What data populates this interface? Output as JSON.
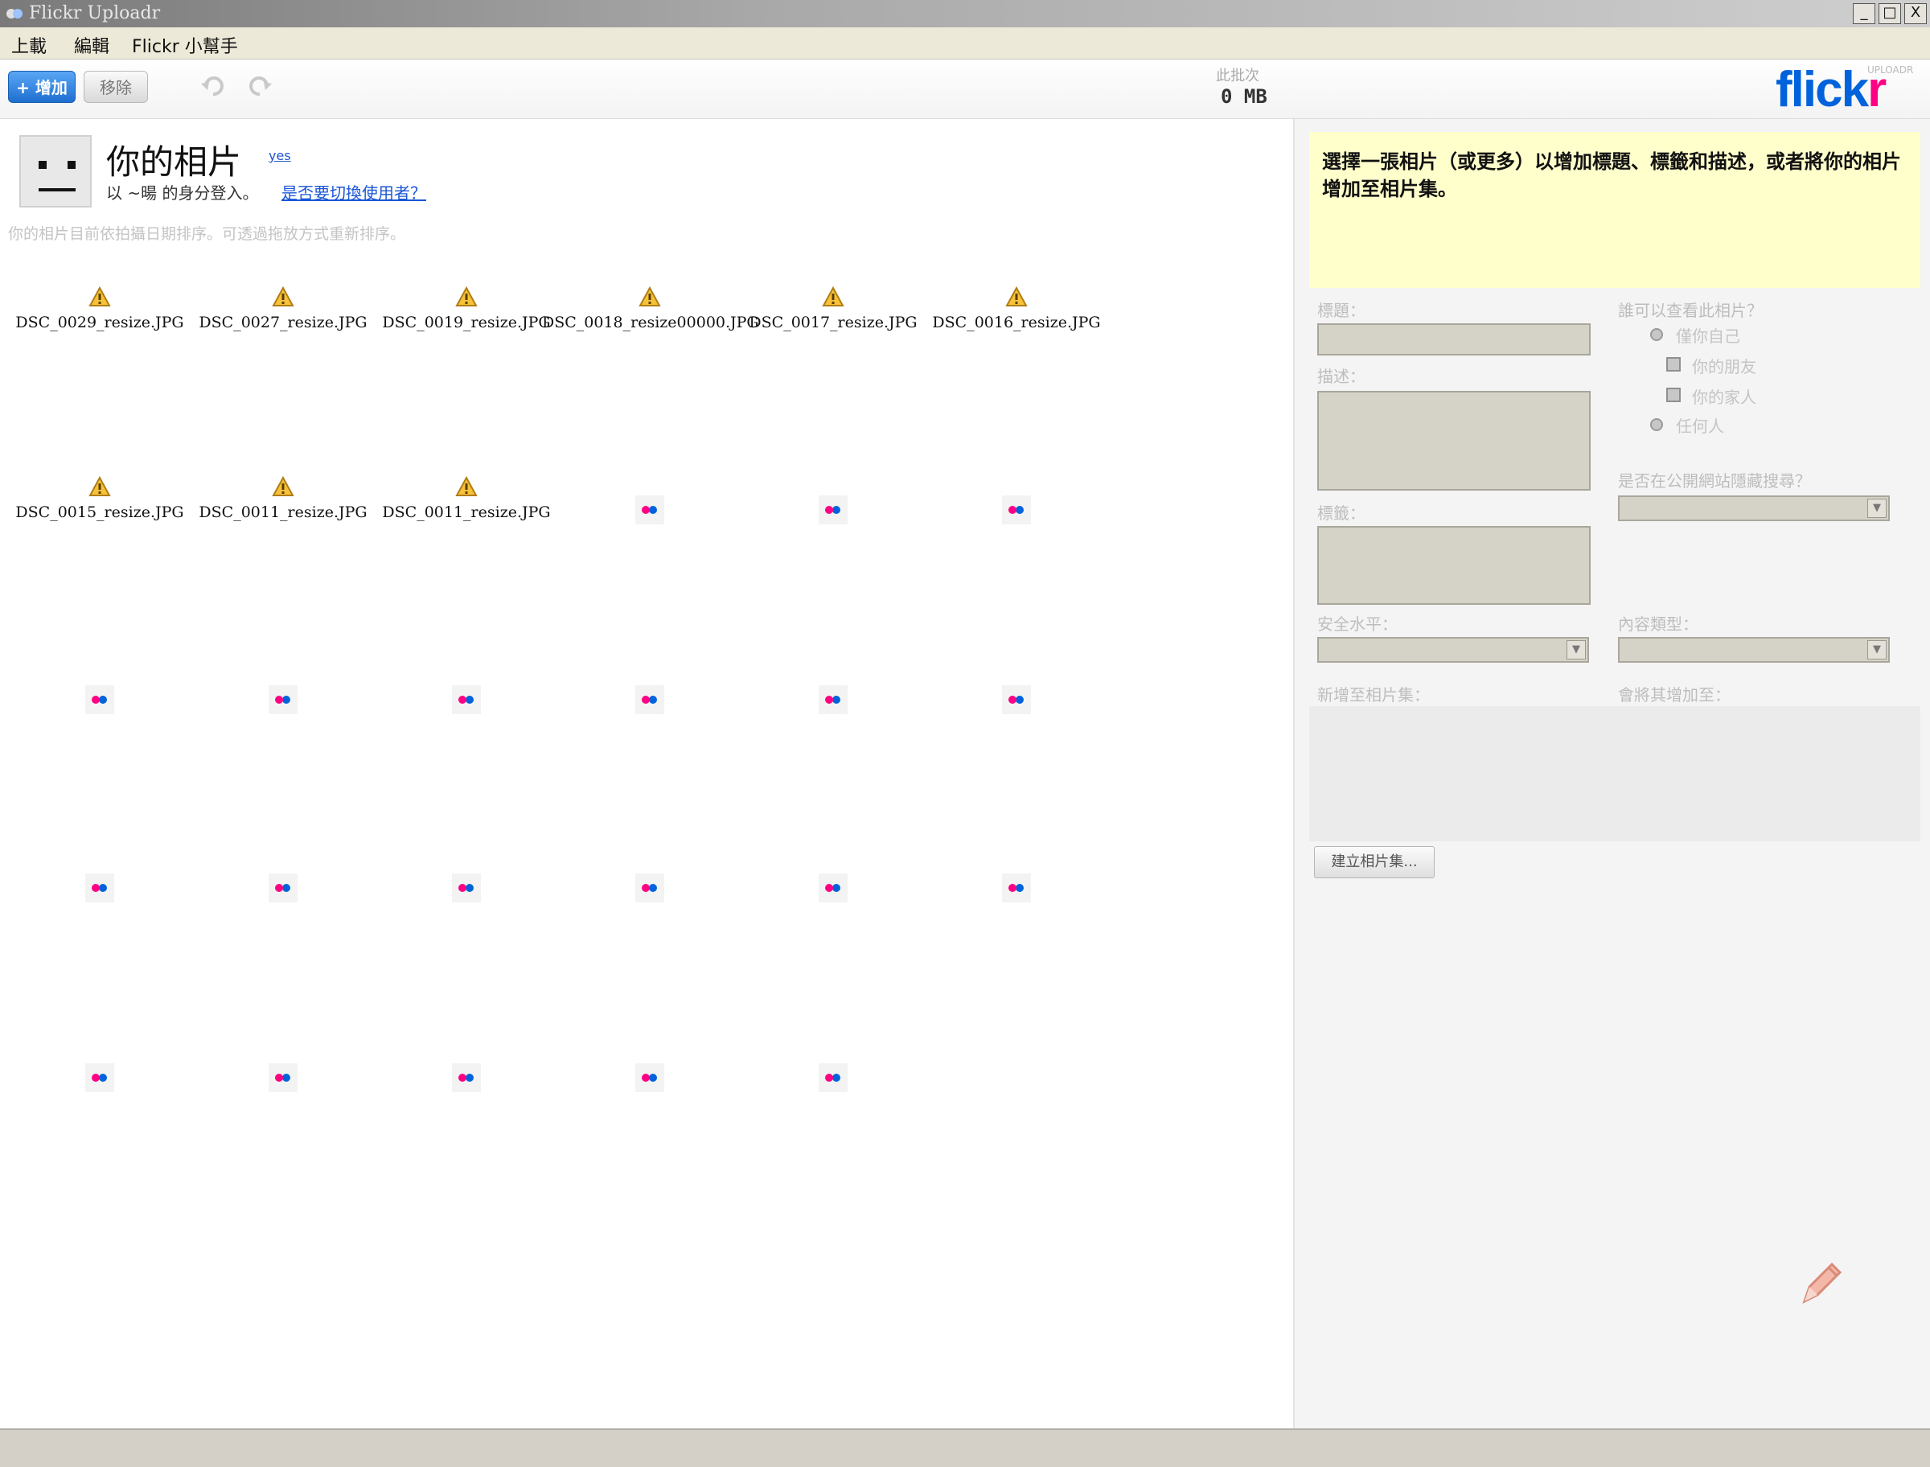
{
  "window": {
    "title": "Flickr Uploadr",
    "controls": [
      "_",
      "□",
      "X"
    ]
  },
  "menubar": {
    "items": [
      "上載",
      "編輯",
      "Flickr 小幫手"
    ]
  },
  "toolbar": {
    "add_label": "+ 增加",
    "remove_label": "移除",
    "size_label": "此批次",
    "size_value": "0 MB",
    "logo_main": "flick",
    "logo_r": "r",
    "logo_sub": "UPLOADR"
  },
  "header": {
    "title": "你的相片",
    "user_small": "yes",
    "signed_in": "以 ~暘 的身分登入。",
    "switch_user": "是否要切換使用者？",
    "sort_note": "你的相片目前依拍攝日期排序。可透過拖放方式重新排序。"
  },
  "photos": [
    {
      "name": "DSC_0029_resize.JPG",
      "state": "warning"
    },
    {
      "name": "DSC_0027_resize.JPG",
      "state": "warning"
    },
    {
      "name": "DSC_0019_resize.JPG",
      "state": "warning"
    },
    {
      "name": "DSC_0018_resize00000.JPG",
      "state": "warning"
    },
    {
      "name": "DSC_0017_resize.JPG",
      "state": "warning"
    },
    {
      "name": "DSC_0016_resize.JPG",
      "state": "warning"
    },
    {
      "name": "DSC_0015_resize.JPG",
      "state": "warning"
    },
    {
      "name": "DSC_0011_resize.JPG",
      "state": "warning"
    },
    {
      "name": "DSC_0011_resize.JPG",
      "state": "warning"
    },
    {
      "name": "",
      "state": "loading"
    },
    {
      "name": "",
      "state": "loading"
    },
    {
      "name": "",
      "state": "loading"
    },
    {
      "name": "",
      "state": "loading"
    },
    {
      "name": "",
      "state": "loading"
    },
    {
      "name": "",
      "state": "loading"
    },
    {
      "name": "",
      "state": "loading"
    },
    {
      "name": "",
      "state": "loading"
    },
    {
      "name": "",
      "state": "loading"
    },
    {
      "name": "",
      "state": "loading"
    },
    {
      "name": "",
      "state": "loading"
    },
    {
      "name": "",
      "state": "loading"
    },
    {
      "name": "",
      "state": "loading"
    },
    {
      "name": "",
      "state": "loading"
    },
    {
      "name": "",
      "state": "loading"
    },
    {
      "name": "",
      "state": "loading"
    },
    {
      "name": "",
      "state": "loading"
    },
    {
      "name": "",
      "state": "loading"
    },
    {
      "name": "",
      "state": "loading"
    },
    {
      "name": "",
      "state": "loading"
    }
  ],
  "side": {
    "hint": "選擇一張相片（或更多）以增加標題、標籤和描述，或者將你的相片增加至相片集。",
    "title_label": "標題：",
    "desc_label": "描述：",
    "tags_label": "標籤：",
    "privacy_label": "誰可以查看此相片？",
    "privacy_options": [
      "僅你自己",
      "你的朋友",
      "你的家人",
      "任何人"
    ],
    "geo_label": "是否在公開網站隱藏搜尋？",
    "safety_label": "安全水平：",
    "content_label": "內容類型：",
    "add_to_set_label": "新增至相片集：",
    "other_label": "會將其增加至：",
    "create_set": "建立相片集..."
  },
  "colors": {
    "flickr_blue": "#0063dc",
    "flickr_pink": "#ff0084",
    "hint_bg": "#ffffcc"
  }
}
